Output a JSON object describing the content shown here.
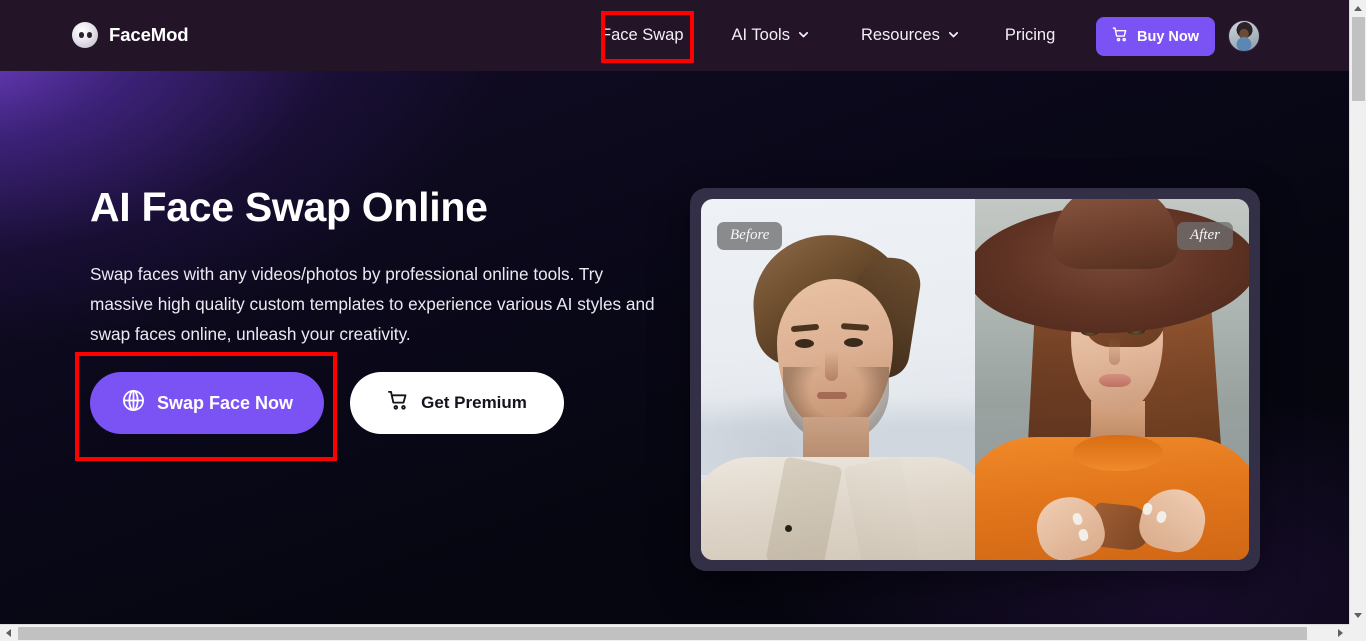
{
  "colors": {
    "header_bg": "#231527",
    "accent_purple": "#7b52f4",
    "page_bg": "#05060f",
    "annotation_red": "#fe0000",
    "card_frame": "#332f46",
    "text_white": "#ffffff"
  },
  "header": {
    "brand": {
      "name": "FaceMod",
      "icon": "face-circle-logo"
    },
    "nav": [
      {
        "label": "Face Swap",
        "has_dropdown": false,
        "highlighted": true
      },
      {
        "label": "AI Tools",
        "has_dropdown": true,
        "highlighted": false
      },
      {
        "label": "Resources",
        "has_dropdown": true,
        "highlighted": false
      },
      {
        "label": "Pricing",
        "has_dropdown": false,
        "highlighted": false
      }
    ],
    "buy_button": {
      "label": "Buy Now",
      "icon": "shopping-cart-icon"
    },
    "avatar": {
      "alt": "user-profile-avatar"
    }
  },
  "hero": {
    "title": "AI Face Swap Online",
    "description": "Swap faces with any videos/photos by professional online tools. Try massive high quality custom templates to experience various AI styles and swap faces online, unleash your creativity.",
    "primary_cta": {
      "label": "Swap Face Now",
      "icon": "globe-icon"
    },
    "secondary_cta": {
      "label": "Get Premium",
      "icon": "shopping-cart-icon"
    }
  },
  "showcase": {
    "before_badge": "Before",
    "after_badge": "After",
    "before_alt": "man-portrait-before-face-swap",
    "after_alt": "woman-with-hat-portrait-after-face-swap"
  },
  "annotations": [
    {
      "target": "nav-item-face-swap",
      "color": "#fe0000"
    },
    {
      "target": "swap-face-now-button",
      "color": "#fe0000"
    }
  ],
  "scrollbars": {
    "vertical_position": "near-top",
    "horizontal_position": "left"
  }
}
